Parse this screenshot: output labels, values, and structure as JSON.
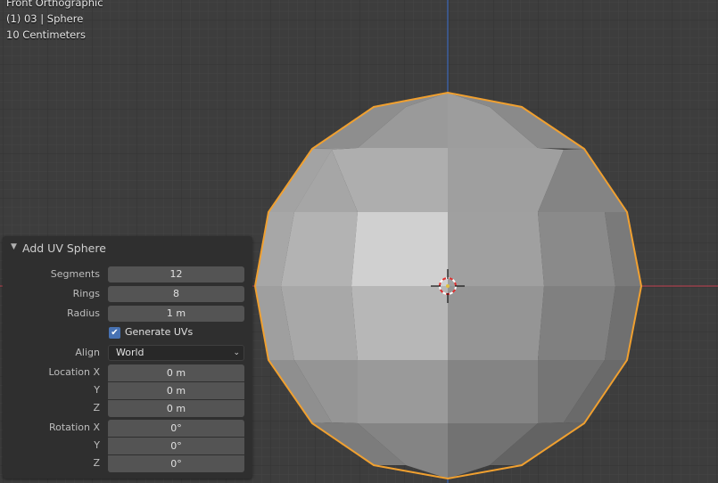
{
  "hud": {
    "view_name": "Front Orthographic",
    "object_info": "(1) 03 | Sphere",
    "grid_scale": "10 Centimeters"
  },
  "panel": {
    "title": "Add UV Sphere",
    "segments": {
      "label": "Segments",
      "value": "12"
    },
    "rings": {
      "label": "Rings",
      "value": "8"
    },
    "radius": {
      "label": "Radius",
      "value": "1 m"
    },
    "generate_uvs": {
      "label": "Generate UVs",
      "checked": true
    },
    "align": {
      "label": "Align",
      "value": "World"
    },
    "location": {
      "label_x": "Location X",
      "label_y": "Y",
      "label_z": "Z",
      "x": "0 m",
      "y": "0 m",
      "z": "0 m"
    },
    "rotation": {
      "label_x": "Rotation X",
      "label_y": "Y",
      "label_z": "Z",
      "x": "0°",
      "y": "0°",
      "z": "0°"
    }
  },
  "colors": {
    "background": "#3d3d3d",
    "grid_minor": "#454545",
    "grid_major": "#353535",
    "x_axis": "#c2404f",
    "z_axis": "#3b6fd1",
    "selection_outline": "#f0a030",
    "panel_bg": "#2f2f2f",
    "checkbox": "#4772b3"
  },
  "icons": {
    "panel_collapse": "triangle-down-icon",
    "checkbox_check": "checkmark-icon",
    "dropdown": "chevron-down-icon",
    "cursor": "3d-cursor-icon"
  }
}
